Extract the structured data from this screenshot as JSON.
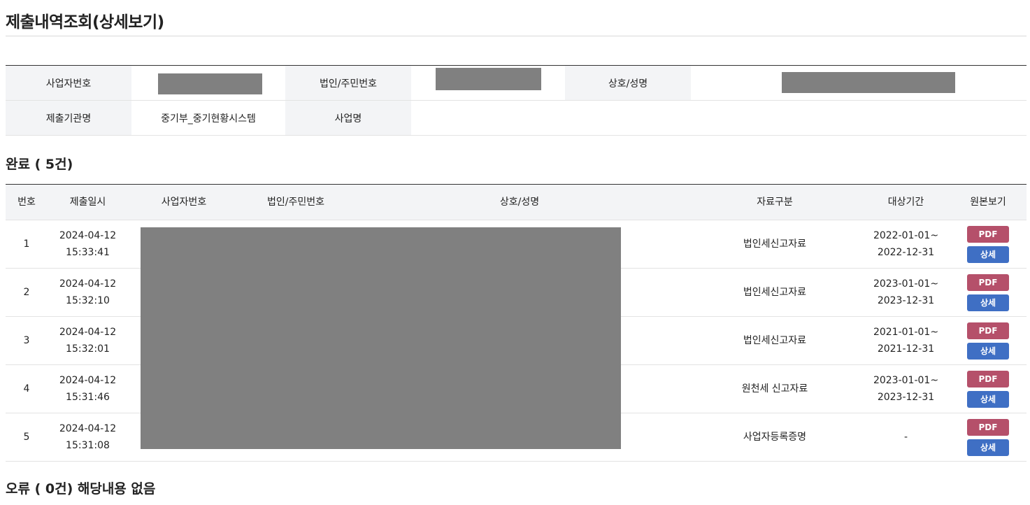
{
  "page": {
    "title": "제출내역조회(상세보기)"
  },
  "info": {
    "row1": {
      "biz_no_label": "사업자번호",
      "corp_no_label": "법인/주민번호",
      "name_label": "상호/성명"
    },
    "row2": {
      "agency_label": "제출기관명",
      "agency_value": "중기부_중기현황시스템",
      "project_label": "사업명",
      "project_value": ""
    }
  },
  "completed": {
    "title": "완료 ( 5건)"
  },
  "table": {
    "headers": {
      "no": "번호",
      "date": "제출일시",
      "biz_no": "사업자번호",
      "corp_no": "법인/주민번호",
      "name": "상호/성명",
      "type": "자료구분",
      "period": "대상기간",
      "view": "원본보기"
    },
    "rows": [
      {
        "no": "1",
        "date": "2024-04-12",
        "time": "15:33:41",
        "type": "법인세신고자료",
        "period_from": "2022-01-01~",
        "period_to": "2022-12-31",
        "pdf": "PDF",
        "detail": "상세"
      },
      {
        "no": "2",
        "date": "2024-04-12",
        "time": "15:32:10",
        "type": "법인세신고자료",
        "period_from": "2023-01-01~",
        "period_to": "2023-12-31",
        "pdf": "PDF",
        "detail": "상세"
      },
      {
        "no": "3",
        "date": "2024-04-12",
        "time": "15:32:01",
        "type": "법인세신고자료",
        "period_from": "2021-01-01~",
        "period_to": "2021-12-31",
        "pdf": "PDF",
        "detail": "상세"
      },
      {
        "no": "4",
        "date": "2024-04-12",
        "time": "15:31:46",
        "type": "원천세 신고자료",
        "period_from": "2023-01-01~",
        "period_to": "2023-12-31",
        "pdf": "PDF",
        "detail": "상세"
      },
      {
        "no": "5",
        "date": "2024-04-12",
        "time": "15:31:08",
        "type": "사업자등록증명",
        "period_from": "-",
        "period_to": "",
        "pdf": "PDF",
        "detail": "상세"
      }
    ]
  },
  "errors": {
    "title": "오류 ( 0건) 해당내용 없음"
  },
  "colors": {
    "pdf_button": "#b5506a",
    "detail_button": "#3f6fc4",
    "redaction": "#808080",
    "label_bg": "#f3f4f6"
  }
}
